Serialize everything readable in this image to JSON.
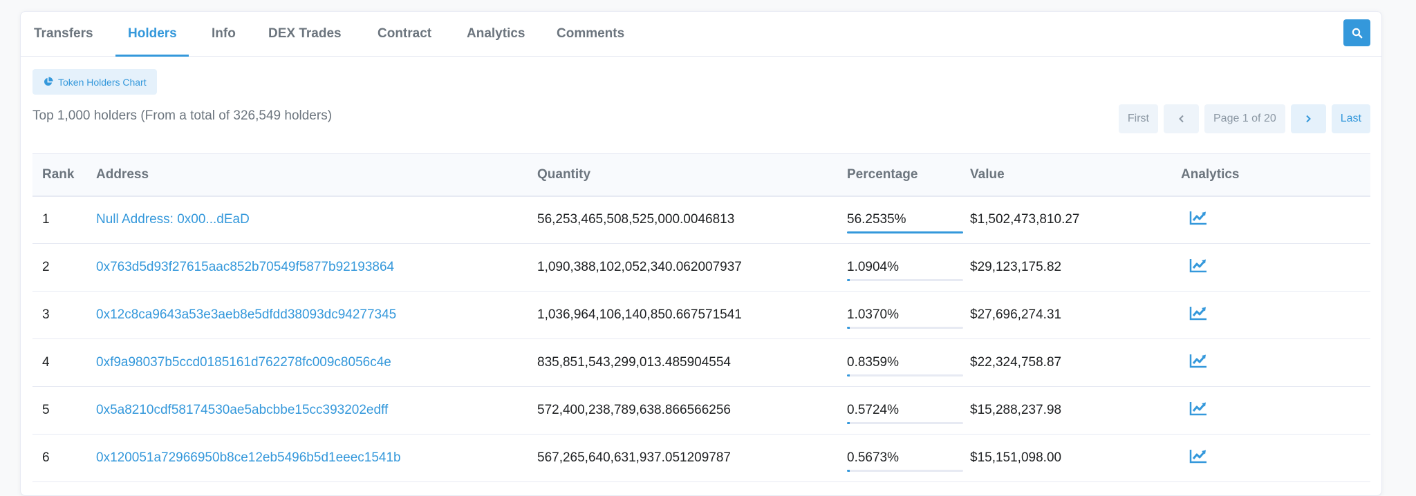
{
  "tabs": [
    {
      "label": "Transfers",
      "name": "tab-transfers",
      "active": false
    },
    {
      "label": "Holders",
      "name": "tab-holders",
      "active": true
    },
    {
      "label": "Info",
      "name": "tab-info",
      "active": false
    },
    {
      "label": "DEX Trades",
      "name": "tab-dex-trades",
      "active": false
    },
    {
      "label": "Contract",
      "name": "tab-contract",
      "active": false
    },
    {
      "label": "Analytics",
      "name": "tab-analytics",
      "active": false
    },
    {
      "label": "Comments",
      "name": "tab-comments",
      "active": false
    }
  ],
  "search_icon": "search-icon",
  "chart_button": {
    "label": "Token Holders Chart",
    "icon": "pie-chart-icon"
  },
  "summary": "Top 1,000 holders (From a total of 326,549 holders)",
  "pagination": {
    "first": "First",
    "prev_icon": "chevron-left-icon",
    "page_info": "Page 1 of 20",
    "next_icon": "chevron-right-icon",
    "last": "Last"
  },
  "table": {
    "headers": {
      "rank": "Rank",
      "address": "Address",
      "quantity": "Quantity",
      "percentage": "Percentage",
      "value": "Value",
      "analytics": "Analytics"
    },
    "rows": [
      {
        "rank": "1",
        "address": "Null Address: 0x00...dEaD",
        "quantity": "56,253,465,508,525,000.0046813",
        "percentage": "56.2535%",
        "pct_fraction": 0.562535,
        "value": "$1,502,473,810.27"
      },
      {
        "rank": "2",
        "address": "0x763d5d93f27615aac852b70549f5877b92193864",
        "quantity": "1,090,388,102,052,340.062007937",
        "percentage": "1.0904%",
        "pct_fraction": 0.010904,
        "value": "$29,123,175.82"
      },
      {
        "rank": "3",
        "address": "0x12c8ca9643a53e3aeb8e5dfdd38093dc94277345",
        "quantity": "1,036,964,106,140,850.667571541",
        "percentage": "1.0370%",
        "pct_fraction": 0.01037,
        "value": "$27,696,274.31"
      },
      {
        "rank": "4",
        "address": "0xf9a98037b5ccd0185161d762278fc009c8056c4e",
        "quantity": "835,851,543,299,013.485904554",
        "percentage": "0.8359%",
        "pct_fraction": 0.008359,
        "value": "$22,324,758.87"
      },
      {
        "rank": "5",
        "address": "0x5a8210cdf58174530ae5abcbbe15cc393202edff",
        "quantity": "572,400,238,789,638.866566256",
        "percentage": "0.5724%",
        "pct_fraction": 0.005724,
        "value": "$15,288,237.98"
      },
      {
        "rank": "6",
        "address": "0x120051a72966950b8ce12eb5496b5d1eeec1541b",
        "quantity": "567,265,640,631,937.051209787",
        "percentage": "0.5673%",
        "pct_fraction": 0.005673,
        "value": "$15,151,098.00"
      }
    ],
    "analytics_icon": "chart-line-icon"
  },
  "colors": {
    "accent": "#3498db",
    "muted_text": "#6c757e",
    "border": "#e7eaf3"
  }
}
